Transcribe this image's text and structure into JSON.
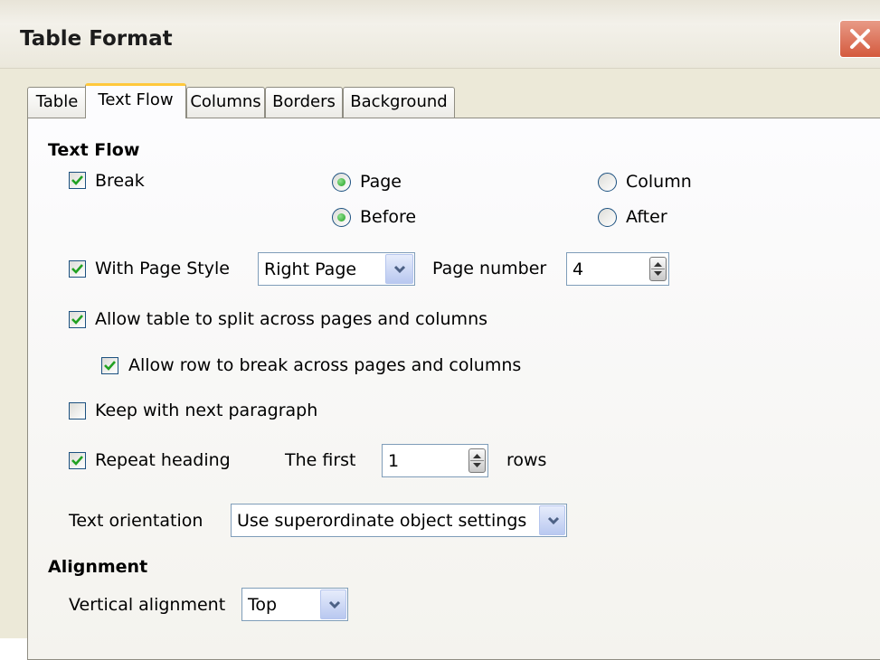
{
  "dialog": {
    "title": "Table Format"
  },
  "tabs": [
    {
      "label": "Table"
    },
    {
      "label": "Text Flow"
    },
    {
      "label": "Columns"
    },
    {
      "label": "Borders"
    },
    {
      "label": "Background"
    }
  ],
  "text_flow": {
    "header": "Text Flow",
    "break": {
      "label": "Break",
      "checked": true
    },
    "page_radio": {
      "label": "Page",
      "selected": true
    },
    "column_radio": {
      "label": "Column",
      "selected": false
    },
    "before_radio": {
      "label": "Before",
      "selected": true
    },
    "after_radio": {
      "label": "After",
      "selected": false
    },
    "with_page_style": {
      "label": "With Page Style",
      "checked": true,
      "value": "Right Page"
    },
    "page_number": {
      "label": "Page number",
      "value": "4"
    },
    "allow_split": {
      "label": "Allow table to split across pages and columns",
      "checked": true
    },
    "allow_row_break": {
      "label": "Allow row to break across pages and columns",
      "checked": true
    },
    "keep_with_next": {
      "label": "Keep with next paragraph",
      "checked": false
    },
    "repeat_heading": {
      "label": "Repeat heading",
      "checked": true,
      "the_first": "The first",
      "value": "1",
      "rows": "rows"
    },
    "text_orientation": {
      "label": "Text orientation",
      "value": "Use superordinate object settings"
    }
  },
  "alignment": {
    "header": "Alignment",
    "vertical": {
      "label": "Vertical alignment",
      "value": "Top"
    }
  },
  "colors": {
    "check": "#21a121",
    "close": "#d45a3e",
    "active_tab_accent": "#ffc83c"
  }
}
